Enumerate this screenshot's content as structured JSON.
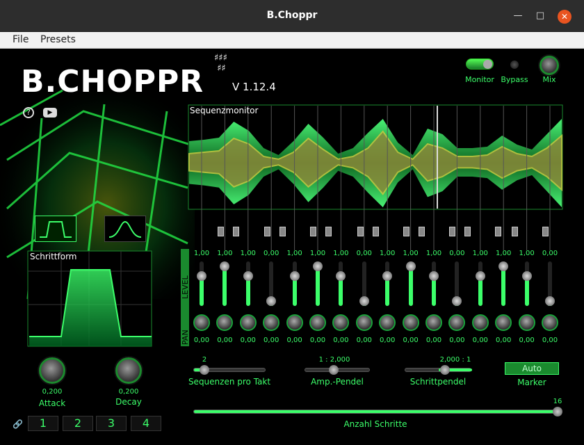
{
  "window": {
    "title": "B.Choppr"
  },
  "menu": {
    "file": "File",
    "presets": "Presets"
  },
  "brand": {
    "name": "B.CHOPPR",
    "version": "V 1.12.4"
  },
  "top_controls": {
    "monitor": "Monitor",
    "bypass": "Bypass",
    "mix": "Mix"
  },
  "monitor_panel": {
    "title": "Sequenzmonitor"
  },
  "step_shape": {
    "title": "Schrittform"
  },
  "attack": {
    "label": "Attack",
    "value": "0,200"
  },
  "decay": {
    "label": "Decay",
    "value": "0,200"
  },
  "steps_labels": {
    "level": "LEVEL",
    "pan": "PAN"
  },
  "levels": [
    "1,00",
    "1,00",
    "1,00",
    "0,00",
    "1,00",
    "1,00",
    "1,00",
    "0,00",
    "1,00",
    "1,00",
    "1,00",
    "0,00",
    "1,00",
    "1,00",
    "1,00",
    "0,00"
  ],
  "level_fractions": [
    0.7,
    0.95,
    0.7,
    0.05,
    0.7,
    0.95,
    0.7,
    0.05,
    0.7,
    0.95,
    0.7,
    0.05,
    0.7,
    0.95,
    0.7,
    0.05
  ],
  "pans": [
    "0,00",
    "0,00",
    "0,00",
    "0,00",
    "0,00",
    "0,00",
    "0,00",
    "0,00",
    "0,00",
    "0,00",
    "0,00",
    "0,00",
    "0,00",
    "0,00",
    "0,00",
    "0,00"
  ],
  "sequences_per_bar": {
    "label": "Sequenzen pro Takt",
    "value": "2"
  },
  "amp_swing": {
    "label": "Amp.-Pendel",
    "value": "1 : 2,000"
  },
  "step_swing": {
    "label": "Schrittpendel",
    "value": "2,000 : 1"
  },
  "marker": {
    "label": "Marker",
    "button": "Auto"
  },
  "step_count": {
    "label": "Anzahl Schritte",
    "value": "16"
  },
  "pattern_buttons": [
    "1",
    "2",
    "3",
    "4"
  ],
  "colors": {
    "accent": "#3cff6a",
    "dark_accent": "#1a8a2e",
    "title_bar": "#2d2d2d",
    "close": "#e95420"
  }
}
